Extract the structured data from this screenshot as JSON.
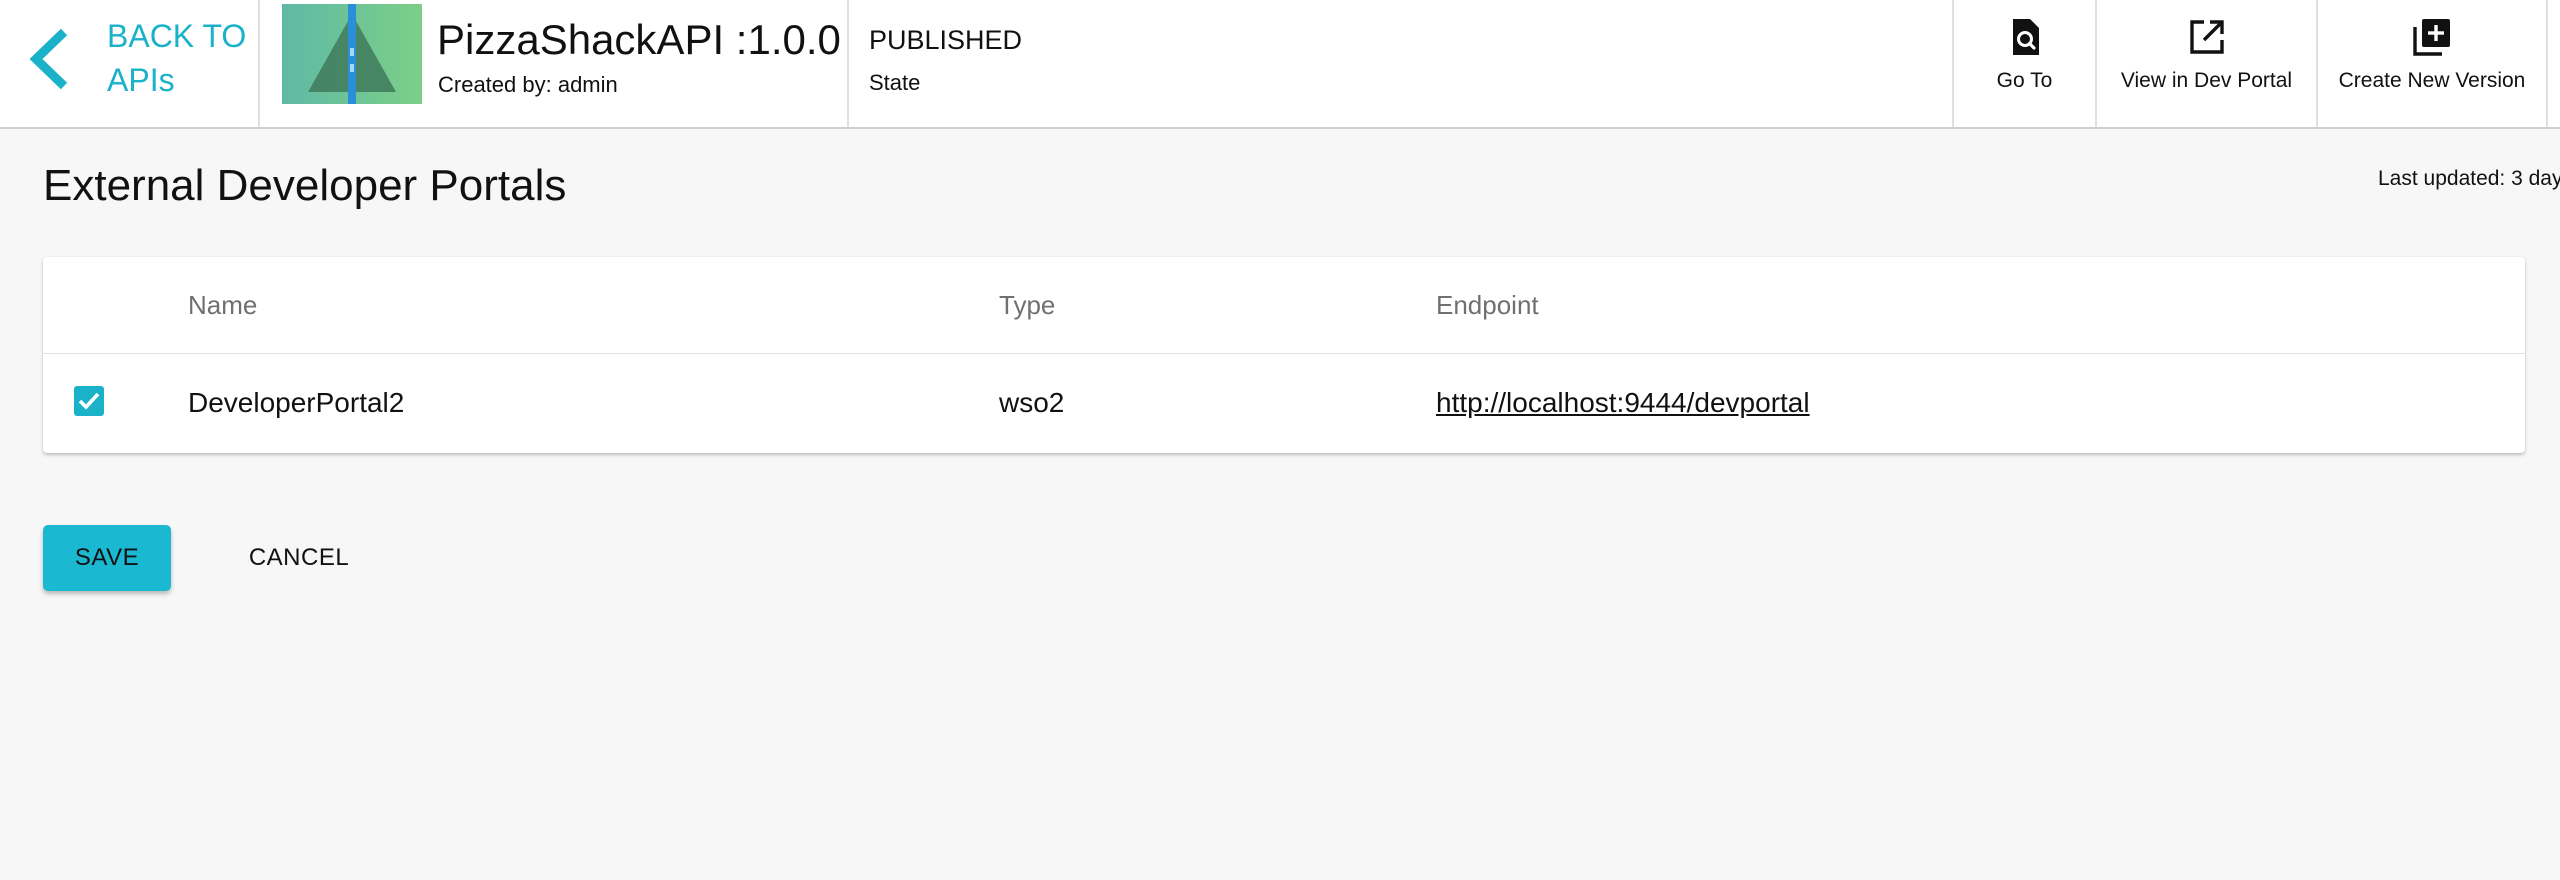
{
  "header": {
    "back": {
      "line1": "BACK TO",
      "line2": "APIs"
    },
    "api": {
      "title": "PizzaShackAPI :1.0.0",
      "created_by": "Created by: admin",
      "thumbnail_icon": "api-thumbnail-triangle"
    },
    "state": {
      "value": "PUBLISHED",
      "label": "State"
    },
    "actions": [
      {
        "label": "Go To",
        "icon": "search-document-icon"
      },
      {
        "label": "View in Dev Portal",
        "icon": "open-external-icon"
      },
      {
        "label": "Create New Version",
        "icon": "add-box-icon"
      }
    ]
  },
  "main": {
    "title": "External Developer Portals",
    "last_updated": "Last updated: 3 day",
    "table": {
      "columns": [
        "Name",
        "Type",
        "Endpoint"
      ],
      "rows": [
        {
          "selected": true,
          "name": "DeveloperPortal2",
          "type": "wso2",
          "endpoint": "http://localhost:9444/devportal"
        }
      ]
    },
    "buttons": {
      "save": "SAVE",
      "cancel": "CANCEL"
    }
  },
  "colors": {
    "accent": "#1ab2c9",
    "save_button": "#1ab8d1",
    "thumb_left": "#5fb9a6",
    "thumb_right": "#7ccf87",
    "thumb_stripe": "#2a8fd6"
  }
}
